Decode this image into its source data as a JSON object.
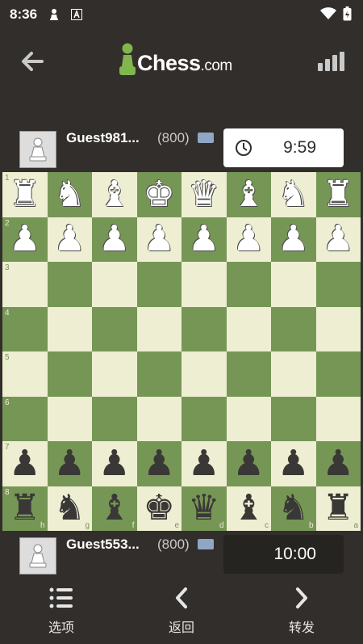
{
  "status_bar": {
    "time": "8:36"
  },
  "app": {
    "logo_main": "Chess",
    "logo_suffix": ".com"
  },
  "top_player": {
    "name": "Guest981...",
    "rating": "(800)",
    "clock": "9:59"
  },
  "bottom_player": {
    "name": "Guest553...",
    "rating": "(800)",
    "clock": "10:00"
  },
  "board": {
    "ranks": [
      "1",
      "2",
      "3",
      "4",
      "5",
      "6",
      "7",
      "8"
    ],
    "files": [
      "h",
      "g",
      "f",
      "e",
      "d",
      "c",
      "b",
      "a"
    ],
    "rows": [
      [
        "wR",
        "wN",
        "wB",
        "wK",
        "wQ",
        "wB",
        "wN",
        "wR"
      ],
      [
        "wP",
        "wP",
        "wP",
        "wP",
        "wP",
        "wP",
        "wP",
        "wP"
      ],
      [
        "",
        "",
        "",
        "",
        "",
        "",
        "",
        ""
      ],
      [
        "",
        "",
        "",
        "",
        "",
        "",
        "",
        ""
      ],
      [
        "",
        "",
        "",
        "",
        "",
        "",
        "",
        ""
      ],
      [
        "",
        "",
        "",
        "",
        "",
        "",
        "",
        ""
      ],
      [
        "bP",
        "bP",
        "bP",
        "bP",
        "bP",
        "bP",
        "bP",
        "bP"
      ],
      [
        "bR",
        "bN",
        "bB",
        "bK",
        "bQ",
        "bB",
        "bN",
        "bR"
      ]
    ]
  },
  "nav": {
    "options": "选项",
    "back": "返回",
    "forward": "转发"
  },
  "icons": [
    "back-arrow-icon",
    "signal-bars-icon",
    "clock-icon",
    "options-list-icon",
    "chevron-left-icon",
    "chevron-right-icon",
    "pawn-avatar-icon"
  ]
}
